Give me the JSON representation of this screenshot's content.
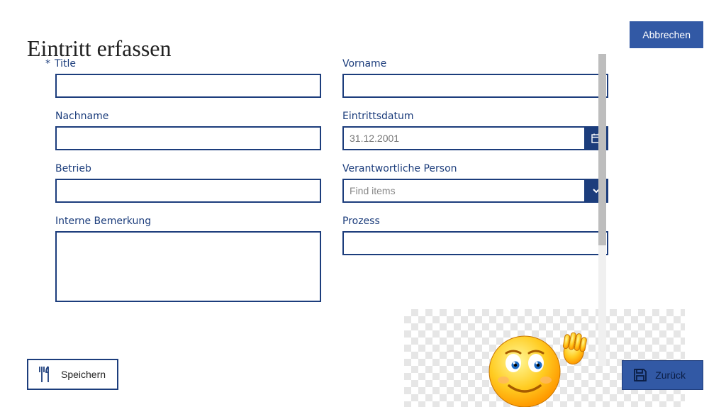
{
  "heading": "Eintritt erfassen",
  "buttons": {
    "cancel": "Abbrechen",
    "save": "Speichern",
    "back": "Zurück"
  },
  "form": {
    "left": {
      "title": {
        "label": "Title",
        "value": "",
        "required": true
      },
      "nachname": {
        "label": "Nachname",
        "value": ""
      },
      "betrieb": {
        "label": "Betrieb",
        "value": ""
      },
      "bemerkung": {
        "label": "Interne Bemerkung",
        "value": ""
      }
    },
    "right": {
      "vorname": {
        "label": "Vorname",
        "value": ""
      },
      "eintrittsdatum": {
        "label": "Eintrittsdatum",
        "value": "31.12.2001"
      },
      "verantwortliche": {
        "label": "Verantwortliche Person",
        "placeholder": "Find items",
        "value": ""
      },
      "prozess": {
        "label": "Prozess",
        "value": ""
      }
    }
  },
  "icons": {
    "save_icon": "fork-knife-icon",
    "back_icon": "save-disk-icon",
    "date_icon": "calendar-icon",
    "combo_icon": "chevron-down-icon",
    "decoration": "waving-smiley-icon"
  }
}
